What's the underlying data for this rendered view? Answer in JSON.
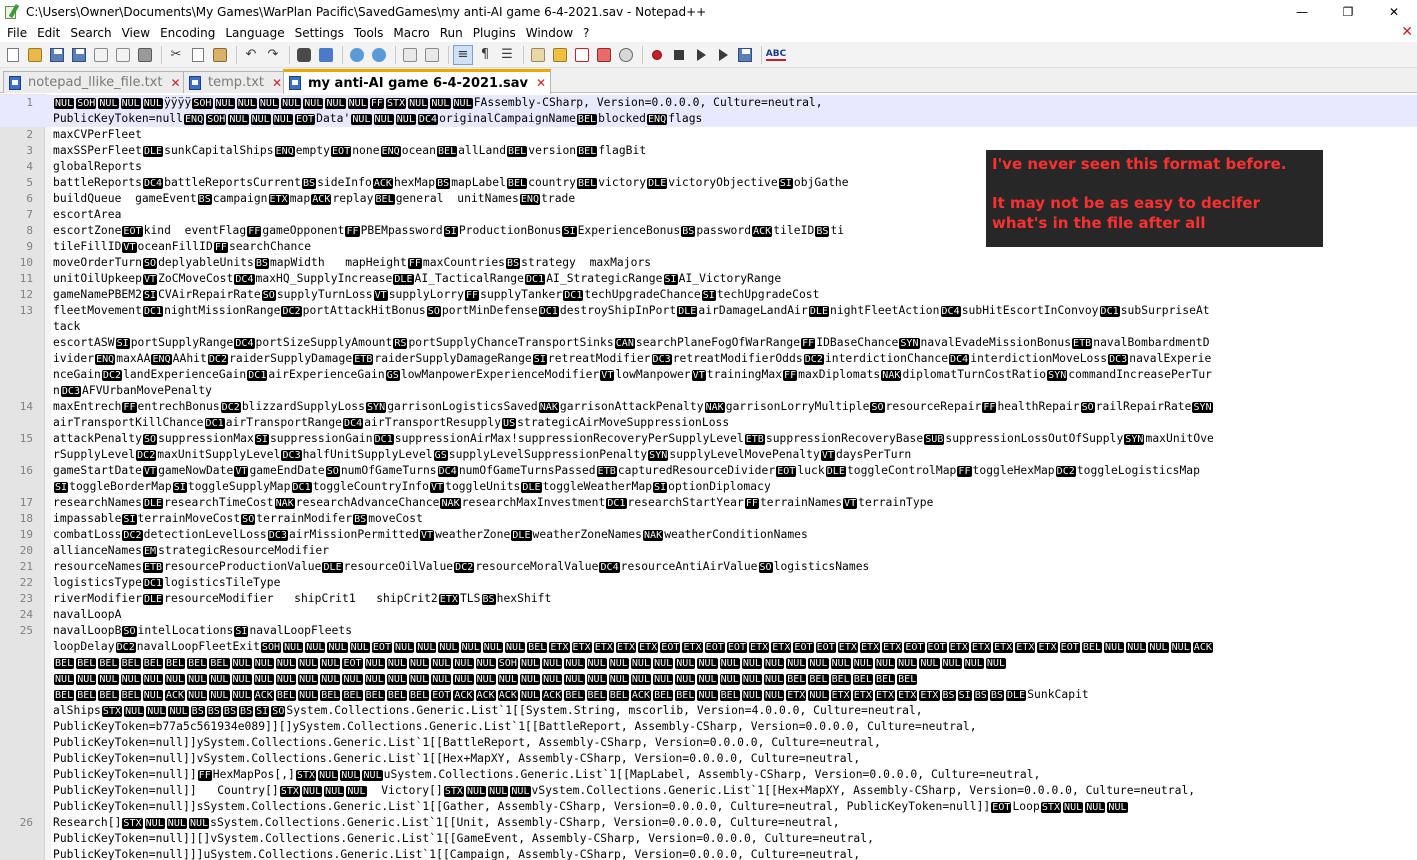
{
  "window": {
    "title": "C:\\Users\\Owner\\Documents\\My Games\\WarPlan Pacific\\SavedGames\\my anti-AI game 6-4-2021.sav - Notepad++",
    "controls": {
      "minimize": "—",
      "restore": "❐",
      "close": "✕"
    }
  },
  "menu": {
    "items": [
      "File",
      "Edit",
      "Search",
      "View",
      "Encoding",
      "Language",
      "Settings",
      "Tools",
      "Macro",
      "Run",
      "Plugins",
      "Window",
      "?"
    ],
    "close_glyph": "✕"
  },
  "toolbar": {
    "icons": [
      "new-file-icon",
      "open-file-icon",
      "save-icon",
      "save-all-icon",
      "close-icon",
      "close-all-icon",
      "print-icon",
      "cut-icon",
      "copy-icon",
      "paste-icon",
      "undo-icon",
      "redo-icon",
      "find-icon",
      "replace-icon",
      "zoom-in-icon",
      "zoom-out-icon",
      "sync-vertical-icon",
      "sync-horizontal-icon",
      "word-wrap-icon",
      "show-all-chars-icon",
      "indent-guide-icon",
      "user-lang-icon",
      "doc-map-icon",
      "function-list-icon",
      "folder-workspace-icon",
      "monitoring-icon",
      "record-macro-icon",
      "stop-record-icon",
      "play-macro-icon",
      "run-macro-multiple-icon",
      "save-macro-icon",
      "spell-check-icon"
    ]
  },
  "tabs": [
    {
      "label": "notepad_llike_file.txt",
      "active": false
    },
    {
      "label": "temp.txt",
      "active": false
    },
    {
      "label": "my anti-AI game 6-4-2021.sav",
      "active": true
    }
  ],
  "annotation": {
    "line1": "I've never seen this format before.",
    "line2": "It may not be as easy to decifer",
    "line3": "what's in the file after all"
  },
  "editor": {
    "lines": [
      {
        "n": "1",
        "t": "⟦NUL⟧⟦SOH⟧⟦NUL⟧⟦NUL⟧⟦NUL⟧ÿÿÿÿ⟦SOH⟧⟦NUL⟧⟦NUL⟧⟦NUL⟧⟦NUL⟧⟦NUL⟧⟦NUL⟧⟦NUL⟧⟦FF⟧⟦STX⟧⟦NUL⟧⟦NUL⟧⟦NUL⟧FAssembly-CSharp, Version=0.0.0.0, Culture=neutral,",
        "cur": true
      },
      {
        "n": "",
        "t": "PublicKeyToken=null⟦ENQ⟧⟦SOH⟧⟦NUL⟧⟦NUL⟧⟦NUL⟧⟦EOT⟧Data'⟦NUL⟧⟦NUL⟧⟦NUL⟧⟦DC4⟧originalCampaignName⟦BEL⟧blocked⟦ENQ⟧flags",
        "cur": true
      },
      {
        "n": "2",
        "t": "maxCVPerFleet"
      },
      {
        "n": "3",
        "t": "maxSSPerFleet⟦DLE⟧sunkCapitalShips⟦ENQ⟧empty⟦EOT⟧none⟦ENQ⟧ocean⟦BEL⟧allLand⟦BEL⟧version⟦BEL⟧flagBit"
      },
      {
        "n": "4",
        "t": "globalReports"
      },
      {
        "n": "5",
        "t": "battleReports⟦DC4⟧battleReportsCurrent⟦BS⟧sideInfo⟦ACK⟧hexMap⟦BS⟧mapLabel⟦BEL⟧country⟦BEL⟧victory⟦DLE⟧victoryObjective⟦SI⟧objGathe"
      },
      {
        "n": "6",
        "t": "buildQueue  gameEvent⟦BS⟧campaign⟦ETX⟧map⟦ACK⟧replay⟦BEL⟧general  unitNames⟦ENQ⟧trade"
      },
      {
        "n": "7",
        "t": "escortArea"
      },
      {
        "n": "8",
        "t": "escortZone⟦EOT⟧kind  eventFlag⟦FF⟧gameOpponent⟦FF⟧PBEMpassword⟦SI⟧ProductionBonus⟦SI⟧ExperienceBonus⟦BS⟧password⟦ACK⟧tileID⟦BS⟧ti"
      },
      {
        "n": "9",
        "t": "tileFillID⟦VT⟧oceanFillID⟦FF⟧searchChance"
      },
      {
        "n": "10",
        "t": "moveOrderTurn⟦SO⟧deplyableUnits⟦BS⟧mapWidth   mapHeight⟦FF⟧maxCountries⟦BS⟧strategy  maxMajors"
      },
      {
        "n": "11",
        "t": "unitOilUpkeep⟦VT⟧ZoCMoveCost⟦DC4⟧maxHQ_SupplyIncrease⟦DLE⟧AI_TacticalRange⟦DC1⟧AI_StrategicRange⟦SI⟧AI_VictoryRange"
      },
      {
        "n": "12",
        "t": "gameNamePBEM2⟦SI⟧CVAirRepairRate⟦SO⟧supplyTurnLoss⟦VT⟧supplyLorry⟦FF⟧supplyTanker⟦DC1⟧techUpgradeChance⟦SI⟧techUpgradeCost"
      },
      {
        "n": "13",
        "t": "fleetMovement⟦DC1⟧nightMissionRange⟦DC2⟧portAttackHitBonus⟦SO⟧portMinDefense⟦DC1⟧destroyShipInPort⟦DLE⟧airDamageLandAir⟦DLE⟧nightFleetAction⟦DC4⟧subHitEscortInConvoy⟦DC1⟧subSurpriseAt"
      },
      {
        "n": "",
        "t": "tack"
      },
      {
        "n": "",
        "t": "escortASW⟦SI⟧portSupplyRange⟦DC4⟧portSizeSupplyAmount⟦RS⟧portSupplyChanceTransportSinks⟦CAN⟧searchPlaneFogOfWarRange⟦FF⟧IDBaseChance⟦SYN⟧navalEvadeMissionBonus⟦ETB⟧navalBombardmentD"
      },
      {
        "n": "",
        "t": "ivider⟦ENQ⟧maxAA⟦ENQ⟧AAhit⟦DC2⟧raiderSupplyDamage⟦ETB⟧raiderSupplyDamageRange⟦SI⟧retreatModifier⟦DC3⟧retreatModifierOdds⟦DC2⟧interdictionChance⟦DC4⟧interdictionMoveLoss⟦DC3⟧navalExperie"
      },
      {
        "n": "",
        "t": "nceGain⟦DC2⟧landExperienceGain⟦DC1⟧airExperienceGain⟦GS⟧lowManpowerExperienceModifier⟦VT⟧lowManpower⟦VT⟧trainingMax⟦FF⟧maxDiplomats⟦NAK⟧diplomatTurnCostRatio⟦SYN⟧commandIncreasePerTur"
      },
      {
        "n": "",
        "t": "n⟦DC3⟧AFVUrbanMovePenalty"
      },
      {
        "n": "14",
        "t": "maxEntrech⟦FF⟧entrechBonus⟦DC2⟧blizzardSupplyLoss⟦SYN⟧garrisonLogisticsSaved⟦NAK⟧garrisonAttackPenalty⟦NAK⟧garrisonLorryMultiple⟦SO⟧resourceRepair⟦FF⟧healthRepair⟦SO⟧railRepairRate⟦SYN⟧"
      },
      {
        "n": "",
        "t": "airTransportKillChance⟦DC1⟧airTransportRange⟦DC4⟧airTransportResupply⟦US⟧strategicAirMoveSuppressionLoss"
      },
      {
        "n": "15",
        "t": "attackPenalty⟦SO⟧suppressionMax⟦SI⟧suppressionGain⟦DC1⟧suppressionAirMax!suppressionRecoveryPerSupplyLevel⟦ETB⟧suppressionRecoveryBase⟦SUB⟧suppressionLossOutOfSupply⟦SYN⟧maxUnitOve"
      },
      {
        "n": "",
        "t": "rSupplyLevel⟦DC2⟧maxUnitSupplyLevel⟦DC3⟧halfUnitSupplyLevel⟦GS⟧supplyLevelSuppressionPenalty⟦SYN⟧supplyLevelMovePenalty⟦VT⟧daysPerTurn"
      },
      {
        "n": "16",
        "t": "gameStartDate⟦VT⟧gameNowDate⟦VT⟧gameEndDate⟦SO⟧numOfGameTurns⟦DC4⟧numOfGameTurnsPassed⟦ETB⟧capturedResourceDivider⟦EOT⟧luck⟦DLE⟧toggleControlMap⟦FF⟧toggleHexMap⟦DC2⟧toggleLogisticsMap"
      },
      {
        "n": "",
        "t": "⟦SI⟧toggleBorderMap⟦SI⟧toggleSupplyMap⟦DC1⟧toggleCountryInfo⟦VT⟧toggleUnits⟦DLE⟧toggleWeatherMap⟦SI⟧optionDiplomacy"
      },
      {
        "n": "17",
        "t": "researchNames⟦DLE⟧researchTimeCost⟦NAK⟧researchAdvanceChance⟦NAK⟧researchMaxInvestment⟦DC1⟧researchStartYear⟦FF⟧terrainNames⟦VT⟧terrainType"
      },
      {
        "n": "18",
        "t": "impassable⟦SI⟧terrainMoveCost⟦SO⟧terrainModifer⟦BS⟧moveCost"
      },
      {
        "n": "19",
        "t": "combatLoss⟦DC2⟧detectionLevelLoss⟦DC3⟧airMissionPermitted⟦VT⟧weatherZone⟦DLE⟧weatherZoneNames⟦NAK⟧weatherConditionNames"
      },
      {
        "n": "20",
        "t": "allianceNames⟦EM⟧strategicResourceModifier"
      },
      {
        "n": "21",
        "t": "resourceNames⟦ETB⟧resourceProductionValue⟦DLE⟧resourceOilValue⟦DC2⟧resourceMoralValue⟦DC4⟧resourceAntiAirValue⟦SO⟧logisticsNames"
      },
      {
        "n": "22",
        "t": "logisticsType⟦DC1⟧logisticsTileType"
      },
      {
        "n": "23",
        "t": "riverModifier⟦DLE⟧resourceModifier   shipCrit1   shipCrit2⟦ETX⟧TLS⟦BS⟧hexShift"
      },
      {
        "n": "24",
        "t": "navalLoopA"
      },
      {
        "n": "25",
        "t": "navalLoopB⟦SO⟧intelLocations⟦SI⟧navalLoopFleets"
      },
      {
        "n": "",
        "t": "loopDelay⟦DC2⟧navalLoopFleetExit⟦SOH⟧⟦NUL⟧⟦NUL⟧⟦NUL⟧⟦NUL⟧⟦EOT⟧⟦NUL⟧⟦NUL⟧⟦NUL⟧⟦NUL⟧⟦NUL⟧⟦NUL⟧⟦BEL⟧⟦ETX⟧⟦ETX⟧⟦ETX⟧⟦ETX⟧⟦ETX⟧⟦EOT⟧⟦ETX⟧⟦EOT⟧⟦EOT⟧⟦ETX⟧⟦ETX⟧⟦EOT⟧⟦EOT⟧⟦ETX⟧⟦ETX⟧⟦ETX⟧⟦EOT⟧⟦EOT⟧⟦ETX⟧⟦ETX⟧⟦ETX⟧⟦ETX⟧⟦ETX⟧⟦EOT⟧⟦BEL⟧⟦NUL⟧⟦NUL⟧⟦NUL⟧⟦NUL⟧⟦ACK⟧"
      },
      {
        "n": "",
        "t": "⟦BEL⟧⟦BEL⟧⟦BEL⟧⟦BEL⟧⟦BEL⟧⟦BEL⟧⟦BEL⟧⟦BEL⟧⟦NUL⟧⟦NUL⟧⟦NUL⟧⟦NUL⟧⟦NUL⟧⟦EOT⟧⟦NUL⟧⟦NUL⟧⟦NUL⟧⟦NUL⟧⟦NUL⟧⟦NUL⟧⟦SOH⟧⟦NUL⟧⟦NUL⟧⟦NUL⟧⟦NUL⟧⟦NUL⟧⟦NUL⟧⟦NUL⟧⟦NUL⟧⟦NUL⟧⟦NUL⟧⟦NUL⟧⟦NUL⟧⟦NUL⟧⟦NUL⟧⟦NUL⟧⟦NUL⟧⟦NUL⟧⟦NUL⟧⟦NUL⟧⟦NUL⟧⟦NUL⟧⟦NUL⟧"
      },
      {
        "n": "",
        "t": "⟦NUL⟧⟦NUL⟧⟦NUL⟧⟦NUL⟧⟦NUL⟧⟦NUL⟧⟦NUL⟧⟦NUL⟧⟦NUL⟧⟦NUL⟧⟦NUL⟧⟦NUL⟧⟦NUL⟧⟦NUL⟧⟦NUL⟧⟦NUL⟧⟦NUL⟧⟦NUL⟧⟦NUL⟧⟦NUL⟧⟦NUL⟧⟦NUL⟧⟦NUL⟧⟦NUL⟧⟦NUL⟧⟦NUL⟧⟦NUL⟧⟦NUL⟧⟦NUL⟧⟦NUL⟧⟦NUL⟧⟦NUL⟧⟦NUL⟧⟦BEL⟧⟦BEL⟧⟦BEL⟧⟦BEL⟧⟦BEL⟧⟦BEL⟧"
      },
      {
        "n": "",
        "t": "⟦BEL⟧⟦BEL⟧⟦BEL⟧⟦BEL⟧⟦NUL⟧⟦ACK⟧⟦NUL⟧⟦NUL⟧⟦NUL⟧⟦ACK⟧⟦BEL⟧⟦NUL⟧⟦BEL⟧⟦BEL⟧⟦BEL⟧⟦BEL⟧⟦BEL⟧⟦EOT⟧⟦ACK⟧⟦ACK⟧⟦ACK⟧⟦NUL⟧⟦ACK⟧⟦BEL⟧⟦BEL⟧⟦BEL⟧⟦ACK⟧⟦BEL⟧⟦BEL⟧⟦NUL⟧⟦BEL⟧⟦NUL⟧⟦NUL⟧⟦ETX⟧⟦NUL⟧⟦ETX⟧⟦ETX⟧⟦ETX⟧⟦ETX⟧⟦ETX⟧⟦BS⟧⟦SI⟧⟦BS⟧⟦BS⟧⟦DLE⟧SunkCapit"
      },
      {
        "n": "",
        "t": "alShips⟦STX⟧⟦NUL⟧⟦NUL⟧⟦NUL⟧⟦BS⟧⟦BS⟧⟦BS⟧⟦BS⟧⟦SI⟧⟦SO⟧System.Collections.Generic.List`1[[System.String, mscorlib, Version=4.0.0.0, Culture=neutral,"
      },
      {
        "n": "",
        "t": "PublicKeyToken=b77a5c561934e089]][]ySystem.Collections.Generic.List`1[[BattleReport, Assembly-CSharp, Version=0.0.0.0, Culture=neutral,"
      },
      {
        "n": "",
        "t": "PublicKeyToken=null]]ySystem.Collections.Generic.List`1[[BattleReport, Assembly-CSharp, Version=0.0.0.0, Culture=neutral,"
      },
      {
        "n": "",
        "t": "PublicKeyToken=null]]vSystem.Collections.Generic.List`1[[Hex+MapXY, Assembly-CSharp, Version=0.0.0.0, Culture=neutral,"
      },
      {
        "n": "",
        "t": "PublicKeyToken=null]]⟦FF⟧HexMapPos[,]⟦STX⟧⟦NUL⟧⟦NUL⟧⟦NUL⟧uSystem.Collections.Generic.List`1[[MapLabel, Assembly-CSharp, Version=0.0.0.0, Culture=neutral,"
      },
      {
        "n": "",
        "t": "PublicKeyToken=null]]   Country[]⟦STX⟧⟦NUL⟧⟦NUL⟧⟦NUL⟧  Victory[]⟦STX⟧⟦NUL⟧⟦NUL⟧⟦NUL⟧vSystem.Collections.Generic.List`1[[Hex+MapXY, Assembly-CSharp, Version=0.0.0.0, Culture=neutral,"
      },
      {
        "n": "",
        "t": "PublicKeyToken=null]]sSystem.Collections.Generic.List`1[[Gather, Assembly-CSharp, Version=0.0.0.0, Culture=neutral, PublicKeyToken=null]]⟦EOT⟧Loop⟦STX⟧⟦NUL⟧⟦NUL⟧⟦NUL⟧"
      },
      {
        "n": "26",
        "t": "Research[]⟦STX⟧⟦NUL⟧⟦NUL⟧⟦NUL⟧sSystem.Collections.Generic.List`1[[Unit, Assembly-CSharp, Version=0.0.0.0, Culture=neutral,"
      },
      {
        "n": "",
        "t": "PublicKeyToken=null]][]vSystem.Collections.Generic.List`1[[GameEvent, Assembly-CSharp, Version=0.0.0.0, Culture=neutral,"
      },
      {
        "n": "",
        "t": "PublicKeyToken=null]]]uSystem.Collections.Generic.List`1[[Campaign, Assembly-CSharp, Version=0.0.0.0, Culture=neutral,"
      }
    ]
  }
}
